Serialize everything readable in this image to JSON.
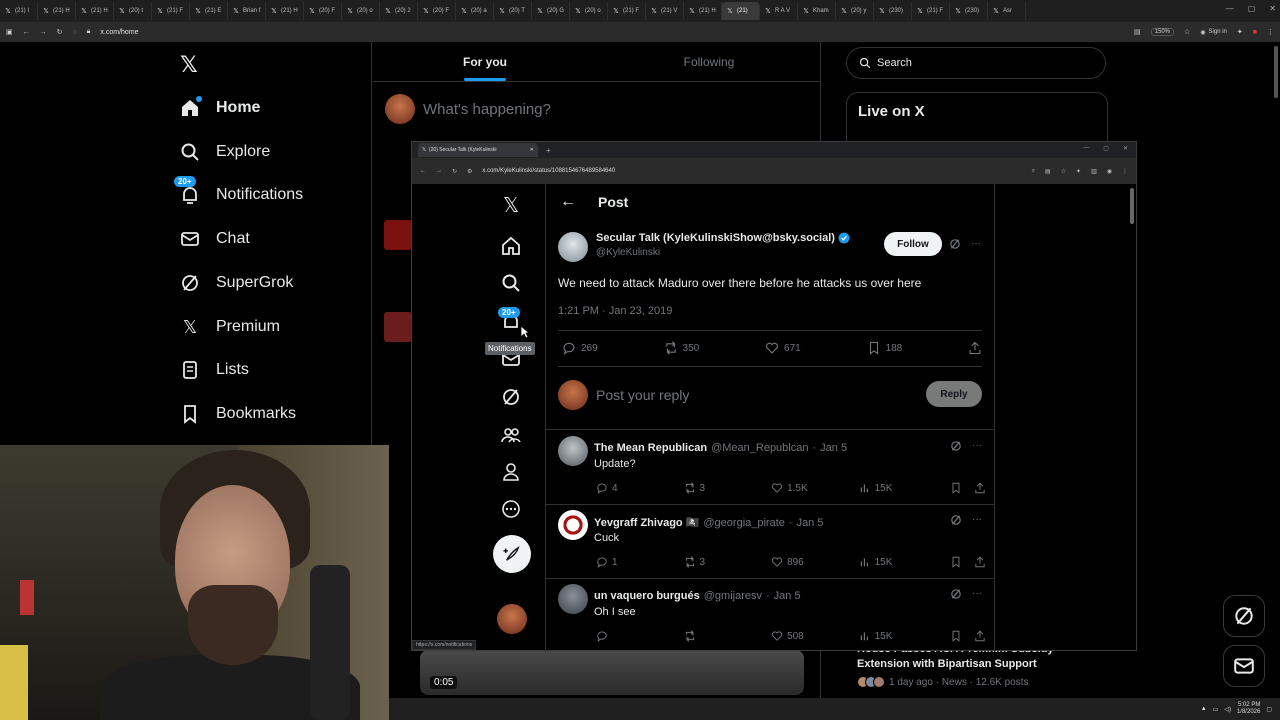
{
  "browser": {
    "tabs": [
      {
        "label": "(21) I"
      },
      {
        "label": "(21) H"
      },
      {
        "label": "(21) H"
      },
      {
        "label": "(20) t"
      },
      {
        "label": "(21) F"
      },
      {
        "label": "(21) E"
      },
      {
        "label": "Brian f"
      },
      {
        "label": "(21) H"
      },
      {
        "label": "(20) F"
      },
      {
        "label": "(20) o"
      },
      {
        "label": "(20) 2"
      },
      {
        "label": "(20) F"
      },
      {
        "label": "(20) a"
      },
      {
        "label": "(20) T"
      },
      {
        "label": "(20) G"
      },
      {
        "label": "(20) o"
      },
      {
        "label": "(21) F"
      },
      {
        "label": "(21) V"
      },
      {
        "label": "(21) H"
      },
      {
        "label": "(21)",
        "active": true
      },
      {
        "label": "R A V"
      },
      {
        "label": "Kham"
      },
      {
        "label": "(20) y"
      },
      {
        "label": "(230)"
      },
      {
        "label": "(21) F"
      },
      {
        "label": "(230)"
      },
      {
        "label": "Asr"
      }
    ],
    "url": "x.com/home",
    "zoom": "150%",
    "signin": "Sign in"
  },
  "left_nav": {
    "items": [
      {
        "label": "Home"
      },
      {
        "label": "Explore"
      },
      {
        "label": "Notifications",
        "badge": "20+"
      },
      {
        "label": "Chat"
      },
      {
        "label": "SuperGrok"
      },
      {
        "label": "Premium"
      },
      {
        "label": "Lists"
      },
      {
        "label": "Bookmarks"
      }
    ]
  },
  "feed": {
    "tabs": [
      {
        "label": "For you"
      },
      {
        "label": "Following"
      }
    ],
    "compose_placeholder": "What's happening?",
    "video_time": "0:05"
  },
  "right_col": {
    "search_placeholder": "Search",
    "live_title": "Live on X",
    "news": {
      "headline": "House Passes ACA Premium Subsidy Extension with Bipartisan Support",
      "meta": "1 day ago · News · 12.6K posts"
    }
  },
  "popup": {
    "tab_title": "(20) Secular Talk (KyleKulinski",
    "url": "x.com/KyleKulinski/status/1088154676489584640",
    "nav_badge": "20+",
    "tooltip": "Notifications",
    "status_url": "https://x.com/notifications",
    "post": {
      "header": "Post",
      "author_name": "Secular Talk (KyleKulinskiShow@bsky.social)",
      "author_handle": "@KyleKulinski",
      "follow_label": "Follow",
      "text": "We need to attack Maduro over there before he attacks us over here",
      "time": "1:21 PM · Jan 23, 2019",
      "stats": {
        "replies": "269",
        "reposts": "350",
        "likes": "671",
        "bookmarks": "188"
      },
      "reply_placeholder": "Post your reply",
      "reply_button": "Reply"
    },
    "replies": [
      {
        "name": "The Mean Republican",
        "handle": "@Mean_Republcan",
        "date": "Jan 5",
        "text": "Update?",
        "replies": "4",
        "reposts": "3",
        "likes": "1.5K",
        "views": "15K"
      },
      {
        "name": "Yevgraff Zhivago 🏴‍☠️",
        "handle": "@georgia_pirate",
        "date": "Jan 5",
        "text": "Cuck",
        "replies": "1",
        "reposts": "3",
        "likes": "896",
        "views": "15K"
      },
      {
        "name": "un vaquero burgués",
        "handle": "@gmijaresv",
        "date": "Jan 5",
        "text": "Oh I see",
        "replies": "",
        "reposts": "",
        "likes": "508",
        "views": "15K"
      }
    ]
  },
  "taskbar": {
    "time": "5:02 PM",
    "date": "1/8/2026"
  },
  "colors": {
    "accent": "#1d9bf0",
    "background": "#000000",
    "text": "#e7e9ea",
    "muted": "#71767b",
    "border": "#2f3336"
  }
}
